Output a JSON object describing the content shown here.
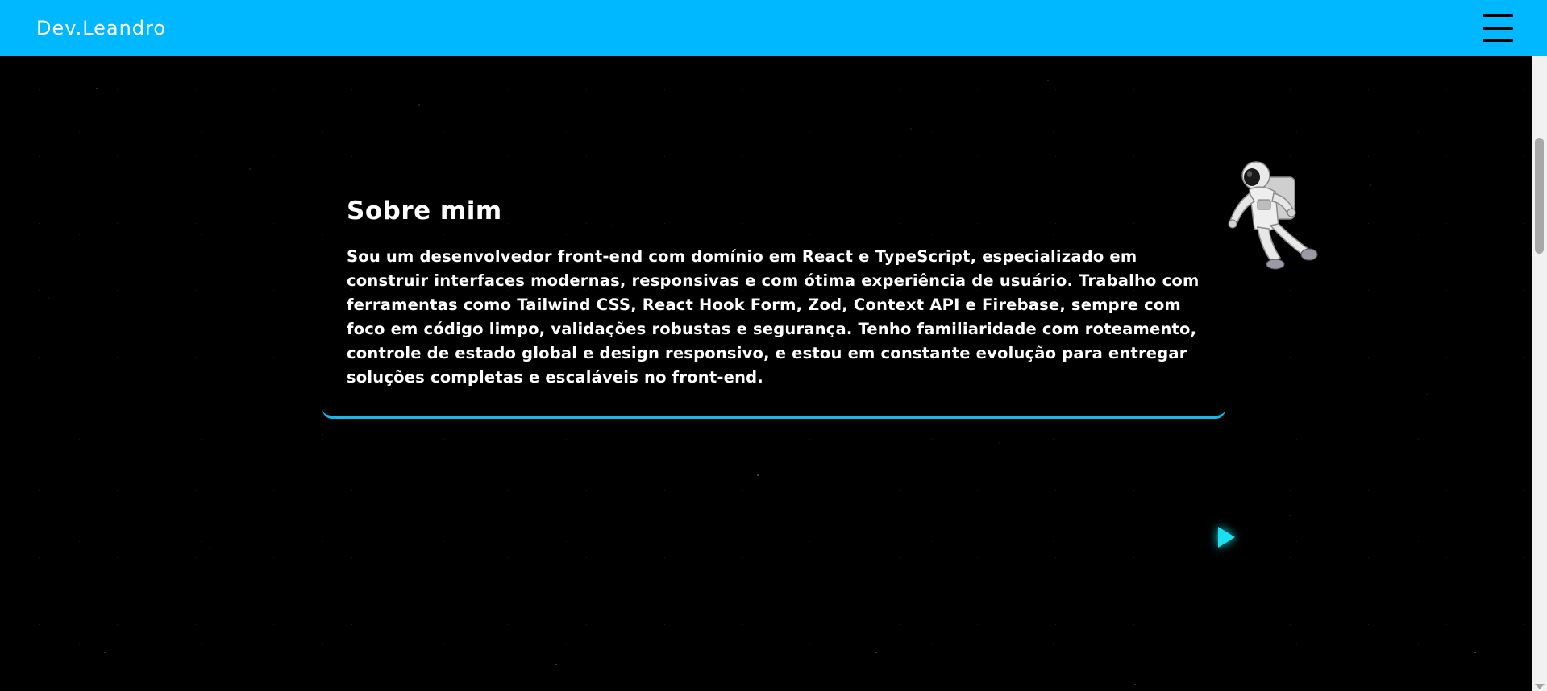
{
  "header": {
    "logo": "Dev.Leandro",
    "menu_icon": "hamburger-menu-icon",
    "background_color": "#00b8ff"
  },
  "about": {
    "title": "Sobre mim",
    "text": "Sou um desenvolvedor front-end com domínio em React e TypeScript, especializado em construir interfaces modernas, responsivas e com ótima experiência de usuário. Trabalho com ferramentas como Tailwind CSS, React Hook Form, Zod, Context API e Firebase, sempre com foco em código limpo, validações robustas e segurança. Tenho familiaridade com roteamento, controle de estado global e design responsivo, e estou em constante evolução para entregar soluções completas e escaláveis no front-end.",
    "accent_color": "#15b8e6"
  },
  "decor": {
    "astronaut_icon": "astronaut-icon",
    "play_icon": "play-arrow-icon",
    "play_color": "#18e0f0"
  }
}
